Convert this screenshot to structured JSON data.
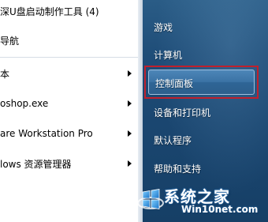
{
  "program_list": [
    {
      "label": "深U盘启动制作工具 (4)",
      "has_arrow": false
    },
    {
      "label": "导航",
      "has_arrow": false
    },
    {
      "label": "本",
      "has_arrow": true
    },
    {
      "label": "oshop.exe",
      "has_arrow": true
    },
    {
      "label": "are Workstation Pro",
      "has_arrow": true
    },
    {
      "label": "lows 资源管理器",
      "has_arrow": true
    }
  ],
  "right_menu": {
    "items": [
      {
        "label": "游戏"
      },
      {
        "label": "计算机"
      },
      {
        "label": "控制面板"
      },
      {
        "label": "设备和打印机"
      },
      {
        "label": "默认程序"
      },
      {
        "label": "帮助和支持"
      }
    ],
    "highlighted_index": 2
  },
  "colors": {
    "right_pane_bg": "#1f4d78",
    "highlight_frame": "#c0202c",
    "highlight_button": "#3a72a4"
  },
  "watermark": {
    "title": "系统之家",
    "subtitle": "Win10net.com",
    "icon": "win-logo-icon"
  }
}
